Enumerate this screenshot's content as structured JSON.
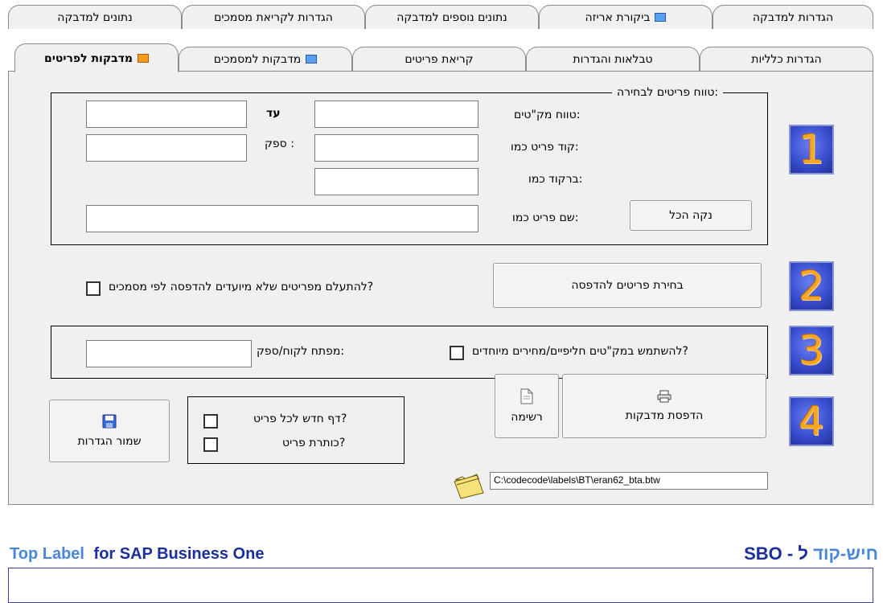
{
  "tabs_row1": [
    {
      "label": "נתונים למדבקה"
    },
    {
      "label": "הגדרות לקריאת מסמכים"
    },
    {
      "label": "נתונים נוספים למדבקה"
    },
    {
      "label": "ביקורת אריזה"
    },
    {
      "label": "הגדרות למדבקה"
    }
  ],
  "tabs_row2": [
    {
      "label": "מדבקות לפריטים",
      "active": true
    },
    {
      "label": "מדבקות למסמכים"
    },
    {
      "label": "קריאת פריטים"
    },
    {
      "label": "טבלאות והגדרות"
    },
    {
      "label": "הגדרות כלליות"
    }
  ],
  "section1": {
    "legend": "טווח פריטים לבחירה:",
    "sku_range_label": "טווח מק\"טים:",
    "to_label": "עד",
    "item_code_like_label": "קוד פריט כמו:",
    "supplier_label": "ספק :",
    "barcode_like_label": "ברקוד כמו:",
    "item_name_like_label": "שם פריט כמו:",
    "clear_all_button": "נקה הכל",
    "sku_from_value": "",
    "sku_to_value": "",
    "item_code_value": "",
    "supplier_value": "",
    "barcode_value": "",
    "item_name_value": ""
  },
  "section2": {
    "select_items_button": "בחירת פריטים להדפסה",
    "ignore_label": "להתעלם מפריטים שלא מיועדים להדפסה לפי מסמכים?",
    "ignore_checked": false
  },
  "section3": {
    "alt_sku_label": "להשתמש במק\"טים חליפיים/מחירים מיוחדים?",
    "alt_sku_checked": false,
    "customer_key_label": "מפתח לקוח/ספק:",
    "customer_key_value": ""
  },
  "section4": {
    "print_labels_button": "הדפסת מדבקות",
    "list_button": "רשימה",
    "new_page_label": "דף חדש לכל פריט?",
    "new_page_checked": false,
    "item_header_label": "כותרת פריט?",
    "item_header_checked": false,
    "save_settings_button": "שמור הגדרות",
    "file_path": "C:\\codecode\\labels\\BT\\eran62_bta.btw"
  },
  "step_numbers": [
    "1",
    "2",
    "3",
    "4"
  ],
  "footer": {
    "brand_left_part1": "Top Label",
    "brand_left_part2": "for  SAP Business One",
    "brand_right_part1": "חיש-קוד",
    "brand_right_part2": "ל - SBO"
  },
  "colors": {
    "brand_light": "#4a86d8",
    "brand_dark": "#1a2ea0",
    "step_orange": "#f5a623",
    "step_blue": "#3a4fd0"
  },
  "icons": {
    "tab_orange_flag": "flag-orange-icon",
    "tab_blue_window": "window-blue-icon",
    "print": "printer-icon",
    "list": "document-icon",
    "save": "floppy-disk-icon",
    "folder": "folder-icon"
  }
}
